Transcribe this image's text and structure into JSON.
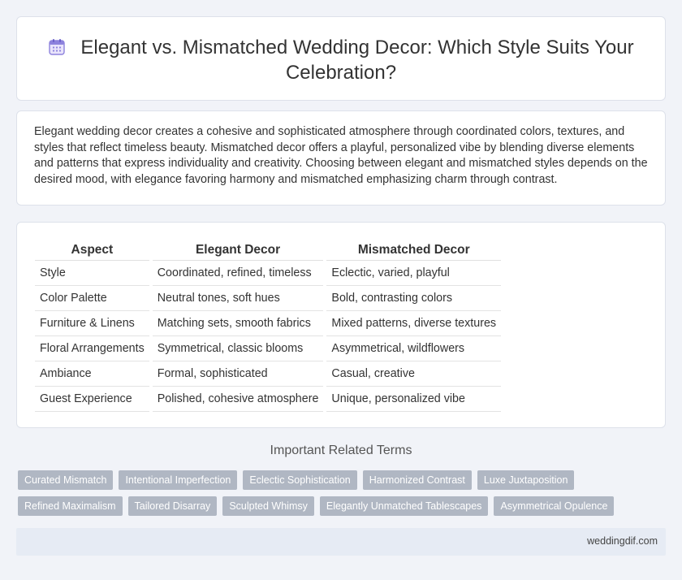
{
  "page": {
    "title": "Elegant vs. Mismatched Wedding Decor: Which Style Suits Your Celebration?",
    "title_icon": "calendar-icon"
  },
  "intro": {
    "text": "Elegant wedding decor creates a cohesive and sophisticated atmosphere through coordinated colors, textures, and styles that reflect timeless beauty. Mismatched decor offers a playful, personalized vibe by blending diverse elements and patterns that express individuality and creativity. Choosing between elegant and mismatched styles depends on the desired mood, with elegance favoring harmony and mismatched emphasizing charm through contrast."
  },
  "table": {
    "headers": [
      "Aspect",
      "Elegant Decor",
      "Mismatched Decor"
    ],
    "rows": [
      [
        "Style",
        "Coordinated, refined, timeless",
        "Eclectic, varied, playful"
      ],
      [
        "Color Palette",
        "Neutral tones, soft hues",
        "Bold, contrasting colors"
      ],
      [
        "Furniture & Linens",
        "Matching sets, smooth fabrics",
        "Mixed patterns, diverse textures"
      ],
      [
        "Floral Arrangements",
        "Symmetrical, classic blooms",
        "Asymmetrical, wildflowers"
      ],
      [
        "Ambiance",
        "Formal, sophisticated",
        "Casual, creative"
      ],
      [
        "Guest Experience",
        "Polished, cohesive atmosphere",
        "Unique, personalized vibe"
      ]
    ]
  },
  "related": {
    "title": "Important Related Terms",
    "tags_row1": [
      "Curated Mismatch",
      "Intentional Imperfection",
      "Eclectic Sophistication",
      "Harmonized Contrast",
      "Luxe Juxtaposition"
    ],
    "tags_row2": [
      "Refined Maximalism",
      "Tailored Disarray",
      "Sculpted Whimsy",
      "Elegantly Unmatched Tablescapes",
      "Asymmetrical Opulence"
    ]
  },
  "footer": {
    "site": "weddingdif.com"
  },
  "colors": {
    "background": "#f1f3f8",
    "tag_bg": "#b0b7c3",
    "footer_bg": "#e6ebf4",
    "icon_purple": "#7b6fd6"
  }
}
